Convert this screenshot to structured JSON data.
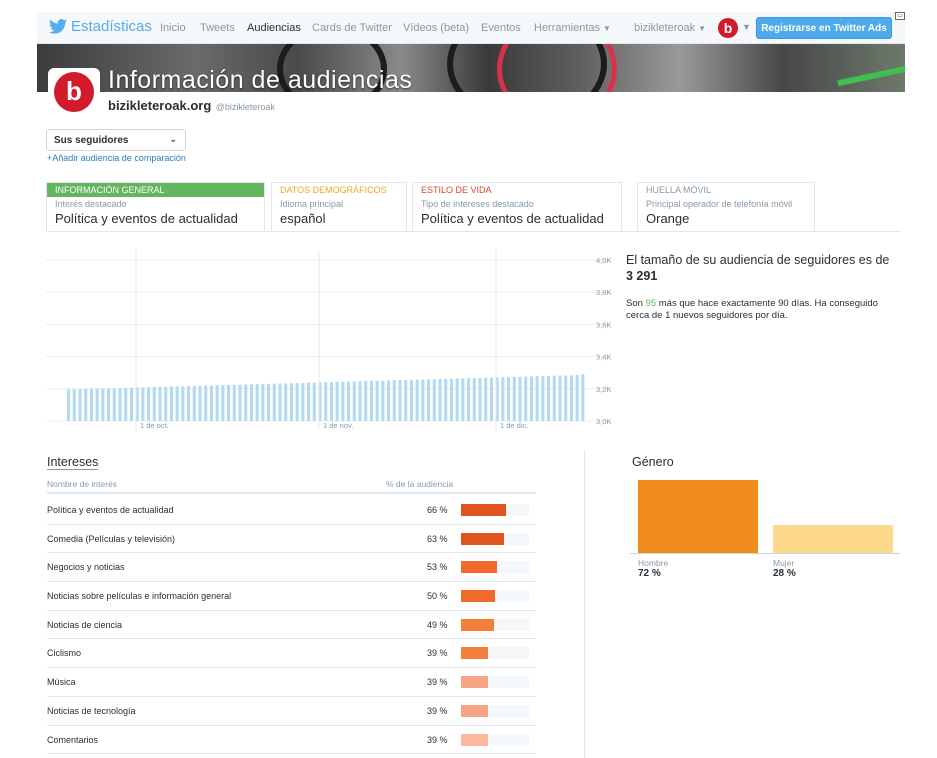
{
  "nav": {
    "brand": "Estadísticas",
    "links": [
      "Inicio",
      "Tweets",
      "Audiencias",
      "Cards de Twitter",
      "Vídeos (beta)",
      "Eventos",
      "Herramientas"
    ],
    "account": "bizikleteroak",
    "account_logo": "b",
    "ads_button": "Registrarse en Twitter Ads",
    "colors": {
      "accent": "#55acee",
      "button": "#4daaeb"
    }
  },
  "banner": {
    "title": "Información de audiencias"
  },
  "profile": {
    "name": "bizikleteroak.org",
    "handle": "@bizikleteroak",
    "logo_letter": "b"
  },
  "audience_select": {
    "value": "Sus seguidores",
    "add_comparison": "+Añadir audiencia de comparación"
  },
  "tabs": [
    {
      "header": "INFORMACIÓN GENERAL",
      "sub": "Interés destacado",
      "value": "Política y eventos de actualidad",
      "color": "#63b65e"
    },
    {
      "header": "DATOS DEMOGRÁFICOS",
      "sub": "Idioma principal",
      "value": "español",
      "color": "#f5a623"
    },
    {
      "header": "ESTILO DE VIDA",
      "sub": "Tipo de intereses destacado",
      "value": "Política y eventos de actualidad",
      "color": "#e0462a"
    },
    {
      "header": "HUELLA MÓVIL",
      "sub": "Principal operador de telefonía móvil",
      "value": "Orange",
      "color": "#8899a6"
    }
  ],
  "chart_data": {
    "type": "bar",
    "y_ticks": [
      "4,0K",
      "3,8K",
      "3,6K",
      "3,4K",
      "3,2K",
      "3,0K"
    ],
    "ylim": [
      3000,
      4000
    ],
    "x_ticks": [
      "1 de oct.",
      "1 de nov.",
      "1 de dic."
    ],
    "values": [
      3196,
      3197,
      3198,
      3199,
      3200,
      3201,
      3202,
      3203,
      3204,
      3205,
      3206,
      3207,
      3208,
      3209,
      3210,
      3211,
      3212,
      3213,
      3214,
      3215,
      3216,
      3217,
      3218,
      3219,
      3220,
      3221,
      3222,
      3223,
      3224,
      3225,
      3226,
      3227,
      3228,
      3229,
      3230,
      3231,
      3232,
      3233,
      3234,
      3235,
      3236,
      3237,
      3238,
      3239,
      3240,
      3241,
      3242,
      3243,
      3244,
      3245,
      3246,
      3247,
      3248,
      3249,
      3250,
      3251,
      3252,
      3253,
      3254,
      3255,
      3256,
      3257,
      3258,
      3259,
      3260,
      3261,
      3262,
      3263,
      3264,
      3265,
      3266,
      3267,
      3268,
      3269,
      3270,
      3271,
      3272,
      3273,
      3274,
      3275,
      3276,
      3277,
      3278,
      3279,
      3280,
      3281,
      3282,
      3283,
      3284,
      3285,
      3291
    ],
    "color": "#b4daf2",
    "grid": true
  },
  "summary": {
    "title_text": "El tamaño de su audiencia de seguidores es de ",
    "title_num": "3 291",
    "desc_pre": "Son ",
    "desc_num": "95",
    "desc_post": " más que hace exactamente 90 días. Ha conseguido cerca de 1 nuevos seguidores por día."
  },
  "interests": {
    "title": "Intereses",
    "col_name": "Nombre de interés",
    "col_pct": "% de la audiencia",
    "rows": [
      {
        "name": "Política y eventos de actualidad",
        "pct": "66 %",
        "value": 66,
        "color": "#e0541e"
      },
      {
        "name": "Comedia (Películas y televisión)",
        "pct": "63 %",
        "value": 63,
        "color": "#e0541e"
      },
      {
        "name": "Negocios y noticias",
        "pct": "53 %",
        "value": 53,
        "color": "#ef6a2b"
      },
      {
        "name": "Noticias sobre películas e información general",
        "pct": "50 %",
        "value": 50,
        "color": "#ef6a2b"
      },
      {
        "name": "Noticias de ciencia",
        "pct": "49 %",
        "value": 49,
        "color": "#f47f3d"
      },
      {
        "name": "Ciclismo",
        "pct": "39 %",
        "value": 39,
        "color": "#f47f3d"
      },
      {
        "name": "Música",
        "pct": "39 %",
        "value": 39,
        "color": "#f7a385"
      },
      {
        "name": "Noticias de tecnología",
        "pct": "39 %",
        "value": 39,
        "color": "#f7a385"
      },
      {
        "name": "Comentarios",
        "pct": "39 %",
        "value": 39,
        "color": "#f9b89f"
      }
    ]
  },
  "gender": {
    "title": "Género",
    "items": [
      {
        "label": "Hombre",
        "pct": "72 %",
        "value": 72,
        "color": "#f08c1c"
      },
      {
        "label": "Mujer",
        "pct": "28 %",
        "value": 28,
        "color": "#fcd98b"
      }
    ]
  }
}
